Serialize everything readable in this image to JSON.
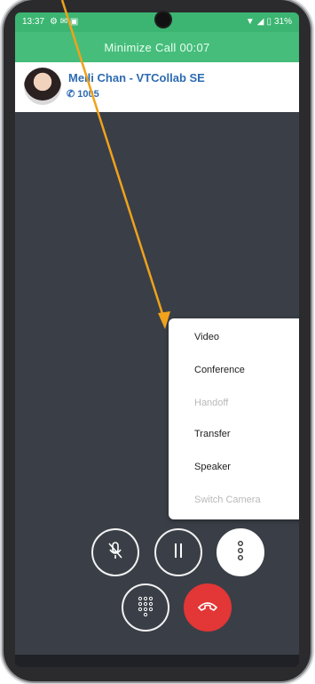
{
  "status_bar": {
    "time": "13:37",
    "battery": "31%"
  },
  "banner": {
    "text": "Minimize Call",
    "timer": "00:07"
  },
  "contact": {
    "name": "Meili Chan - VTCollab SE",
    "extension": "1005"
  },
  "menu": {
    "items": [
      {
        "label": "Video",
        "enabled": true
      },
      {
        "label": "Conference",
        "enabled": true
      },
      {
        "label": "Handoff",
        "enabled": false
      },
      {
        "label": "Transfer",
        "enabled": true
      },
      {
        "label": "Speaker",
        "enabled": true
      },
      {
        "label": "Switch Camera",
        "enabled": false
      }
    ]
  },
  "controls": {
    "mute": "mic-off-icon",
    "hold": "pause-icon",
    "more": "more-vertical-icon",
    "keypad": "dialpad-icon",
    "end": "end-call-icon"
  },
  "colors": {
    "status_green": "#3cb572",
    "banner_green": "#46bd7b",
    "call_bg": "#3a3f47",
    "contact_blue": "#2d6bb3",
    "end_red": "#e33636",
    "arrow": "#f0a21b"
  }
}
